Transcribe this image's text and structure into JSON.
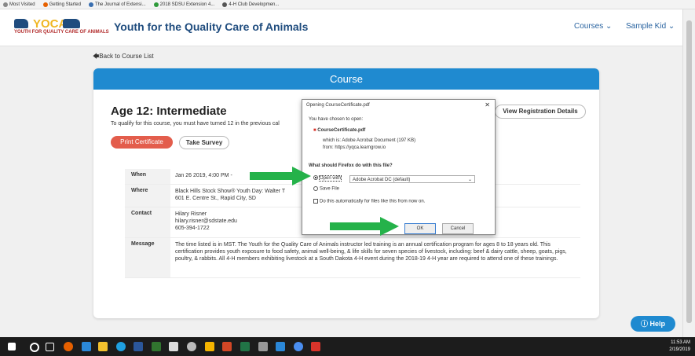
{
  "bookmarks": [
    "Most Visited",
    "Getting Started",
    "The Journal of Extensi...",
    "2018 SDSU Extension 4...",
    "4-H Club Developmen..."
  ],
  "logo": {
    "top": "YOCA",
    "bottom": "YOUTH FOR QUALITY CARE OF ANIMALS"
  },
  "header": {
    "brand": "Youth for the Quality Care of Animals",
    "nav_courses": "Courses",
    "nav_user": "Sample Kid"
  },
  "back_link": "Back to Course List",
  "card": {
    "heading": "Course",
    "title": "Age 12: Intermediate",
    "qualify": "To qualify for this course, you must have turned 12 in the previous cal",
    "print_button": "Print Certificate",
    "survey_button": "Take Survey",
    "registration_button": "View Registration Details",
    "rows": [
      {
        "key": "When",
        "value": "Jan 26 2019, 4:00 PM -"
      },
      {
        "key": "Where",
        "value": "Black Hills Stock Show® Youth Day: Walter T",
        "value2": "601 E. Centre St., Rapid City, SD"
      },
      {
        "key": "Contact",
        "value": "Hilary Risner",
        "value2": "hilary.risner@sdstate.edu",
        "value3": "605-394-1722"
      },
      {
        "key": "Message",
        "value": "The time listed is in MST. The Youth for the Quality Care of Animals instructor led training is an annual certification program for ages 8 to 18 years old. This certification provides youth exposure to food safety, animal well-being, & life skills for seven species of livestock, including: beef & dairy cattle, sheep, goats, pigs, poultry, & rabbits. All 4-H members exhibiting livestock at a South Dakota 4-H event during the 2018-19 4-H year are required to attend one of these trainings."
      }
    ]
  },
  "dialog": {
    "title": "Opening CourseCertificate.pdf",
    "chosen": "You have chosen to open:",
    "filename": "CourseCertificate.pdf",
    "which_is": "which is: Adobe Acrobat Document (197 KB)",
    "from": "from: https://yqca.learngrow.io",
    "question": "What should Firefox do with this file?",
    "open_with": "Open with",
    "app": "Adobe Acrobat DC  (default)",
    "save_file": "Save File",
    "auto": "Do this automatically for files like this from now on.",
    "ok": "OK",
    "cancel": "Cancel"
  },
  "help": "Help",
  "clock": {
    "time": "11:53 AM",
    "date": "2/19/2019"
  },
  "colors": {
    "brand": "#1f4c7e",
    "accent": "#1f8ad0",
    "print": "#e35d4c",
    "arrow": "#25b24a"
  }
}
